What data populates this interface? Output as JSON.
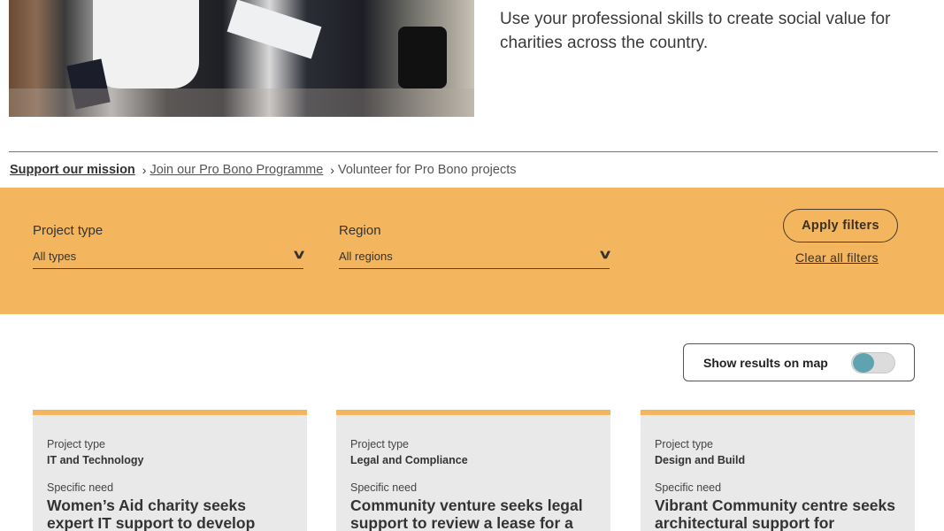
{
  "hero": {
    "photo_alt": "Volunteers reviewing plans outdoors",
    "text": "Use your professional skills to create social value for charities across the country."
  },
  "breadcrumb": {
    "items": [
      {
        "label": "Support our mission"
      },
      {
        "label": "Join our Pro Bono Programme"
      },
      {
        "label": "Volunteer for Pro Bono projects"
      }
    ],
    "separator_icon": "chevron-right-icon"
  },
  "filters": {
    "project_type": {
      "label": "Project type",
      "value": "All types",
      "icon": "chevron-down-icon"
    },
    "region": {
      "label": "Region",
      "value": "All regions",
      "icon": "chevron-down-icon"
    },
    "apply_label": "Apply filters",
    "clear_label": "Clear all filters",
    "background_color": "#f3b55d"
  },
  "map_toggle": {
    "label": "Show results on map",
    "enabled": false,
    "knob_color": "#5fa3b0"
  },
  "cards": [
    {
      "type_label": "Project type",
      "type_value": "IT and Technology",
      "need_label": "Specific need",
      "title": "Women’s Aid charity seeks expert IT support to develop robust"
    },
    {
      "type_label": "Project type",
      "type_value": "Legal and Compliance",
      "need_label": "Specific need",
      "title": "Community venture seeks legal support to review a lease for a new"
    },
    {
      "type_label": "Project type",
      "type_value": "Design and Build",
      "need_label": "Specific need",
      "title": "Vibrant Community centre seeks architectural support for"
    }
  ]
}
